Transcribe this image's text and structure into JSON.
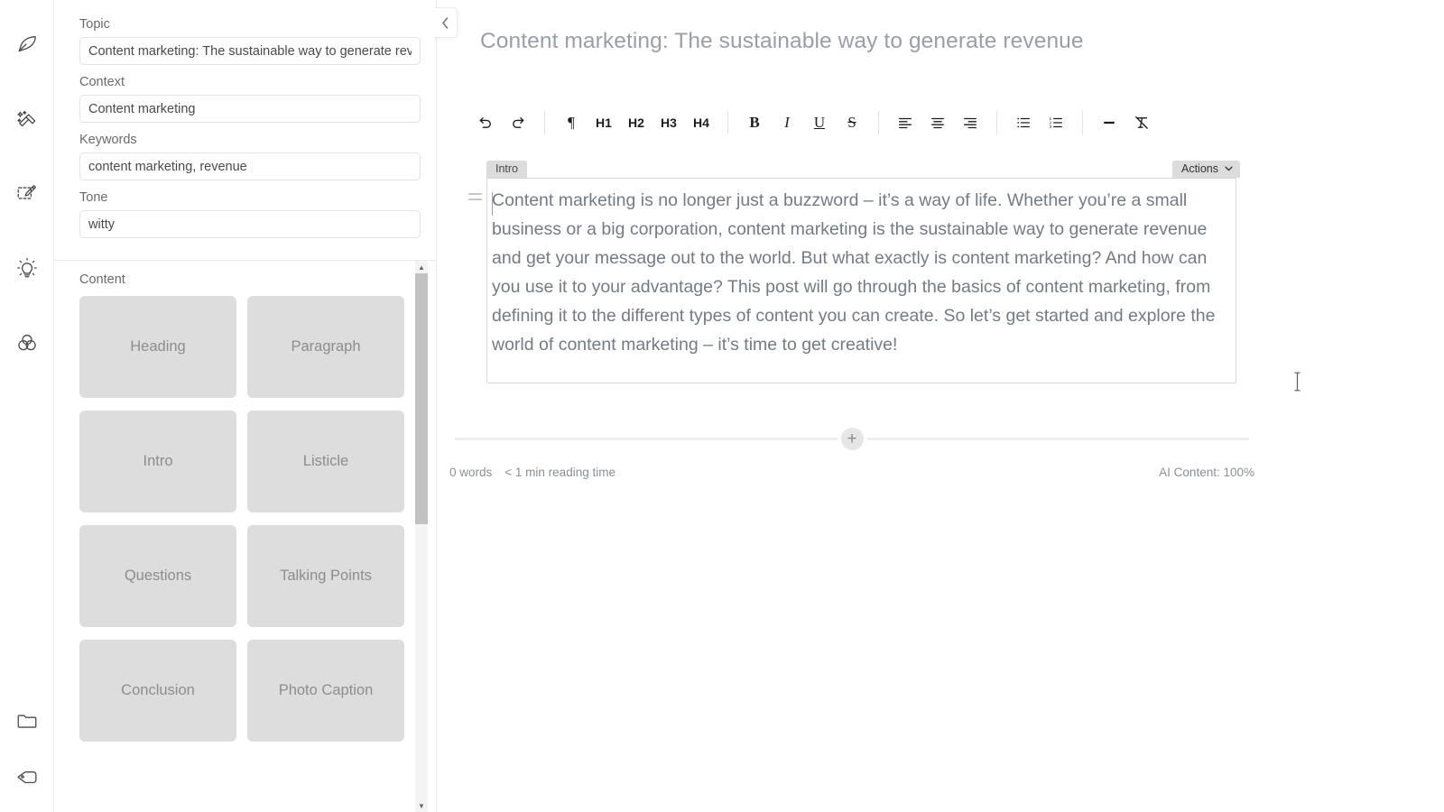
{
  "rail": {
    "items": [
      {
        "name": "feather-icon",
        "label": "Write"
      },
      {
        "name": "magic-wand-icon",
        "label": "Magic tools"
      },
      {
        "name": "edit-box-icon",
        "label": "Edit"
      },
      {
        "name": "lightbulb-icon",
        "label": "Ideas"
      },
      {
        "name": "venn-diagram-icon",
        "label": "Blend"
      },
      {
        "name": "folder-icon",
        "label": "Projects"
      },
      {
        "name": "tag-icon",
        "label": "Tags"
      }
    ]
  },
  "sidebar": {
    "collapse_label": "‹",
    "fields": [
      {
        "label": "Topic",
        "value": "Content marketing: The sustainable way to generate reve",
        "placeholder": "Topic"
      },
      {
        "label": "Context",
        "value": "Content marketing",
        "placeholder": "Context"
      },
      {
        "label": "Keywords",
        "value": "content marketing, revenue",
        "placeholder": "Keywords"
      },
      {
        "label": "Tone",
        "value": "witty",
        "placeholder": "Tone"
      }
    ],
    "blocks_title": "Content",
    "blocks": [
      "Heading",
      "Paragraph",
      "Intro",
      "Listicle",
      "Questions",
      "Talking Points",
      "Conclusion",
      "Photo Caption"
    ]
  },
  "editor": {
    "doc_title": "Content marketing: The sustainable way to generate revenue",
    "toolbar": {
      "groups": [
        [
          {
            "name": "undo-icon",
            "label": "↺",
            "kind": "icon"
          },
          {
            "name": "redo-icon",
            "label": "↻",
            "kind": "icon"
          }
        ],
        [
          {
            "name": "paragraph-icon",
            "label": "¶",
            "kind": "icon"
          },
          {
            "name": "heading-1-button",
            "label": "H1",
            "kind": "text"
          },
          {
            "name": "heading-2-button",
            "label": "H2",
            "kind": "text"
          },
          {
            "name": "heading-3-button",
            "label": "H3",
            "kind": "text"
          },
          {
            "name": "heading-4-button",
            "label": "H4",
            "kind": "text"
          }
        ],
        [
          {
            "name": "bold-button",
            "label": "B",
            "kind": "text"
          },
          {
            "name": "italic-button",
            "label": "I",
            "kind": "text"
          },
          {
            "name": "underline-button",
            "label": "U",
            "kind": "text"
          },
          {
            "name": "strikethrough-button",
            "label": "S",
            "kind": "text"
          }
        ],
        [
          {
            "name": "align-left-icon",
            "label": "align-left",
            "kind": "icon"
          },
          {
            "name": "align-center-icon",
            "label": "align-center",
            "kind": "icon"
          },
          {
            "name": "align-right-icon",
            "label": "align-right",
            "kind": "icon"
          }
        ],
        [
          {
            "name": "bullet-list-icon",
            "label": "bullet-list",
            "kind": "icon"
          },
          {
            "name": "numbered-list-icon",
            "label": "numbered-list",
            "kind": "icon"
          }
        ],
        [
          {
            "name": "horizontal-rule-icon",
            "label": "horizontal-rule",
            "kind": "icon"
          },
          {
            "name": "clear-format-icon",
            "label": "clear-format",
            "kind": "icon"
          }
        ]
      ]
    },
    "block": {
      "tag": "Intro",
      "actions_label": "Actions",
      "text": "Content marketing is no longer just a buzzword – it’s a way of life. Whether you’re a small business or a big corporation, content marketing is the sustainable way to generate revenue and get your message out to the world. But what exactly is content marketing? And how can you use it to your advantage? This post will go through the basics of content marketing, from defining it to the different types of content you can create. So let’s get started and explore the world of content marketing – it’s time to get creative!"
    },
    "add_block_label": "+",
    "status": {
      "word_count": "0 words",
      "reading_time": "< 1 min reading time",
      "ai_content": "AI Content: 100%"
    }
  },
  "colors": {
    "block_card": "#dddddd",
    "tag_bg": "#dcdcdc",
    "text_muted": "#8b8f96",
    "editor_text": "#737b85",
    "panel_border": "#e7e7e7"
  }
}
